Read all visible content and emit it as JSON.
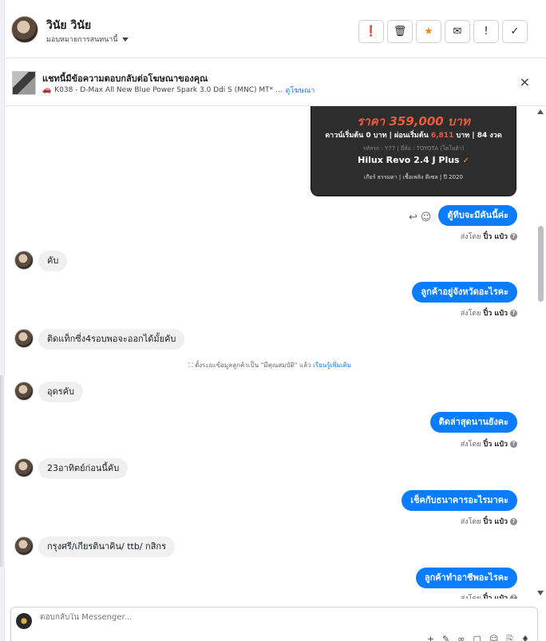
{
  "header": {
    "user_name": "วินัย วินัย",
    "assign_label": "มอบหมายการสนทนานี้",
    "actions": [
      {
        "icon": "alert-circle-icon",
        "glyph": "❗"
      },
      {
        "icon": "trash-icon",
        "glyph": "🗑"
      },
      {
        "icon": "star-icon",
        "glyph": "★"
      },
      {
        "icon": "mark-unread-icon",
        "glyph": "✉"
      },
      {
        "icon": "exclamation-icon",
        "glyph": "!"
      },
      {
        "icon": "check-icon",
        "glyph": "✓"
      }
    ]
  },
  "banner": {
    "title": "แชทนี้มีข้อความตอบกลับต่อโฆษณาของคุณ",
    "subtitle": "K038 - D-Max All New Blue Power Spark 3.0 Ddi S (MNC) MT* ...",
    "link": "ดูโฆษณา",
    "close": "×"
  },
  "ad_card": {
    "price": "ราคา 359,000 บาท",
    "terms_left": "ดาวน์เริ่มต้น 0 บาท | ผ่อนเริ่มต้น ",
    "installment": "6,811",
    "terms_right": " บาท | 84 งวด",
    "specs": "รหัสรถ : Y77 | ยี่ห้อ : TOYOTA (โตโยต้า)",
    "model": "Hilux Revo 2.4 J Plus",
    "features": "เกียร์ ธรรมดา | เชื้อเพลิง ดีเซล | ปี 2020"
  },
  "messages": [
    {
      "dir": "out",
      "text": "ตู้ทีบจะมีคันนี้ค่ะ"
    },
    {
      "dir": "in",
      "text": "คับ"
    },
    {
      "dir": "out",
      "text": "ลูกค้าอยู่จังหวัดอะไรคะ"
    },
    {
      "dir": "in",
      "text": "ติดแท็กซี่ง4รอบพอจะออกได้มั้ยคับ"
    },
    {
      "dir": "in",
      "text": "อุดรคับ"
    },
    {
      "dir": "out",
      "text": "ติดล่าสุดนานยังคะ"
    },
    {
      "dir": "in",
      "text": "23อาทิตย์ก่อนนี้คับ"
    },
    {
      "dir": "out",
      "text": "เช็คกับธนาคารอะไรมาคะ"
    },
    {
      "dir": "in",
      "text": "กรุงศรี/เกียรตินาคิน/ ttb/ กสิกร"
    },
    {
      "dir": "out",
      "text": "ลูกค้าทำอาชีพอะไรคะ"
    }
  ],
  "sent_by": {
    "prefix": "ส่งโดย",
    "name": "ปิ๋ว แป๋ว"
  },
  "system_note": {
    "text": "ตั้งระยะข้อมูลลูกค้าเป็น \"มีคุณสมบัติ\" แล้ว",
    "link": "เรียนรู้เพิ่มเติม"
  },
  "composer": {
    "placeholder": "ตอบกลับใน Messenger..."
  }
}
